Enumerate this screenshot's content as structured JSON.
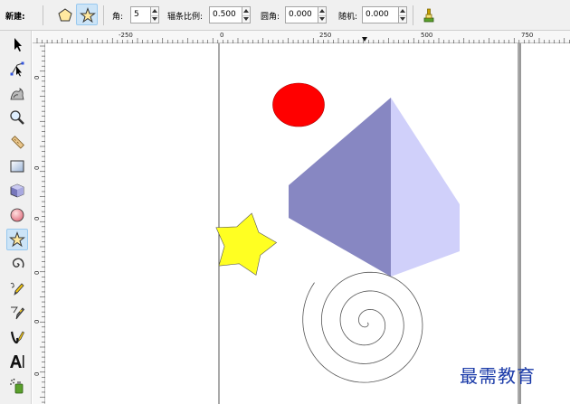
{
  "toolbar": {
    "new_label": "新建:",
    "mode_polygon_icon": "polygon-icon",
    "mode_star_icon": "star-icon",
    "corners_label": "角:",
    "corners_value": "5",
    "spoke_ratio_label": "辐条比例:",
    "spoke_ratio_value": "0.500",
    "rounded_label": "圆角:",
    "rounded_value": "0.000",
    "random_label": "随机:",
    "random_value": "0.000",
    "reset_icon": "reset-defaults-icon"
  },
  "toolbox": {
    "tools": [
      {
        "icon": "selector-arrow-icon"
      },
      {
        "icon": "node-edit-icon"
      },
      {
        "icon": "tweak-icon"
      },
      {
        "icon": "zoom-icon"
      },
      {
        "icon": "measure-icon"
      },
      {
        "icon": "rectangle-icon"
      },
      {
        "icon": "3d-box-icon"
      },
      {
        "icon": "ellipse-icon"
      },
      {
        "icon": "star-polygon-icon",
        "active": true
      },
      {
        "icon": "spiral-icon"
      },
      {
        "icon": "pencil-icon"
      },
      {
        "icon": "pen-icon"
      },
      {
        "icon": "calligraphy-icon"
      },
      {
        "icon": "text-icon"
      },
      {
        "icon": "spray-icon"
      }
    ]
  },
  "rulers": {
    "horizontal_labels": [
      "-250",
      "0",
      "250",
      "500",
      "750"
    ],
    "vertical_labels": [
      "0",
      "0",
      "0",
      "0",
      "0",
      "0"
    ]
  },
  "canvas": {
    "shapes": [
      {
        "type": "ellipse",
        "fill": "#ff0000"
      },
      {
        "type": "3d-box",
        "left_face": "#8787c2",
        "right_face": "#d0d0fa"
      },
      {
        "type": "star",
        "fill": "#ffff22",
        "points": 5
      },
      {
        "type": "spiral",
        "stroke": "#555555"
      }
    ]
  },
  "watermark": "最需教育",
  "colors": {
    "toolbar_bg": "#f0f0f0",
    "active_bg": "#cce4f7",
    "canvas_bg": "#ffffff",
    "page_border": "#555555"
  }
}
